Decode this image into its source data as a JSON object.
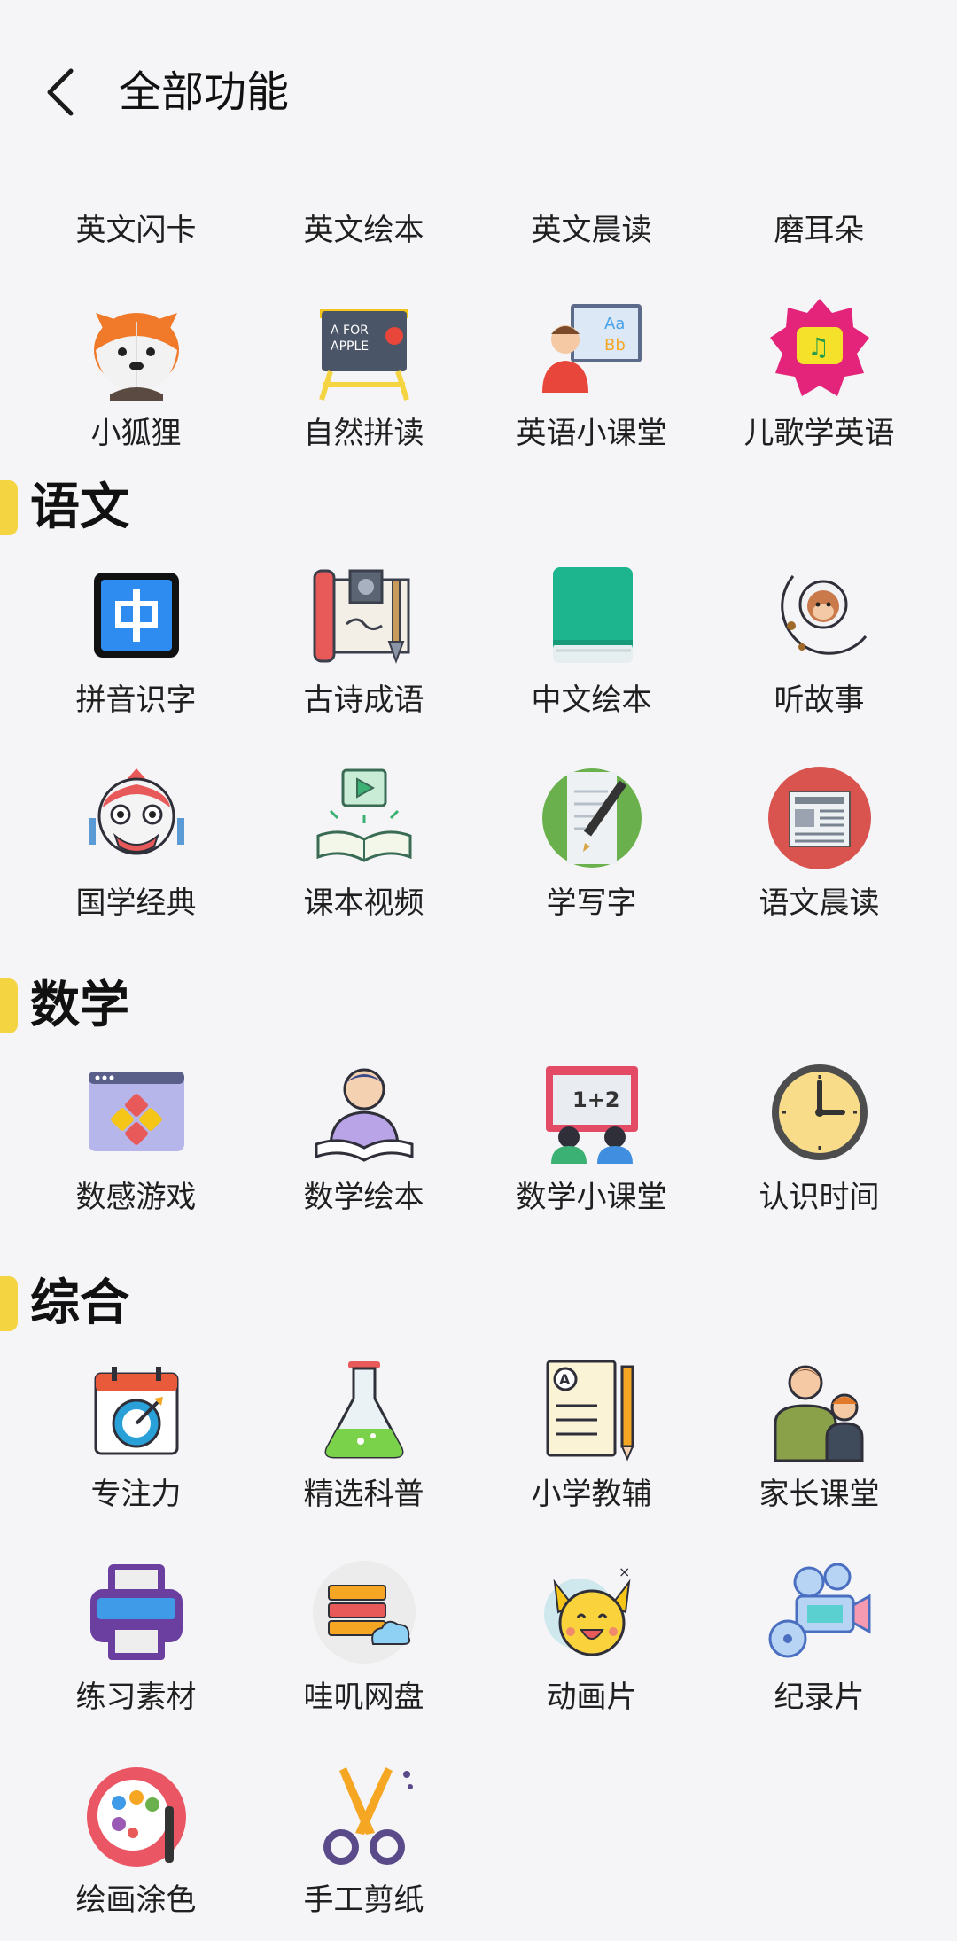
{
  "header": {
    "title": "全部功能"
  },
  "english_partial": [
    {
      "label": "英文闪卡",
      "icon": "flashcard-icon"
    },
    {
      "label": "英文绘本",
      "icon": "picture-book-icon"
    },
    {
      "label": "英文晨读",
      "icon": "morning-read-icon"
    },
    {
      "label": "磨耳朵",
      "icon": "ear-training-icon"
    }
  ],
  "english_row2": [
    {
      "label": "小狐狸",
      "icon": "fox-icon"
    },
    {
      "label": "自然拼读",
      "icon": "phonics-board-icon"
    },
    {
      "label": "英语小课堂",
      "icon": "english-class-icon"
    },
    {
      "label": "儿歌学英语",
      "icon": "music-badge-icon"
    }
  ],
  "sections": [
    {
      "title": "语文",
      "items": [
        {
          "label": "拼音识字",
          "icon": "pinyin-icon"
        },
        {
          "label": "古诗成语",
          "icon": "scroll-icon"
        },
        {
          "label": "中文绘本",
          "icon": "green-book-icon"
        },
        {
          "label": "听故事",
          "icon": "moon-monkey-icon"
        },
        {
          "label": "国学经典",
          "icon": "lion-dance-icon"
        },
        {
          "label": "课本视频",
          "icon": "video-book-icon"
        },
        {
          "label": "学写字",
          "icon": "writing-pen-icon"
        },
        {
          "label": "语文晨读",
          "icon": "newspaper-icon"
        }
      ]
    },
    {
      "title": "数学",
      "items": [
        {
          "label": "数感游戏",
          "icon": "calculator-window-icon"
        },
        {
          "label": "数学绘本",
          "icon": "reading-student-icon"
        },
        {
          "label": "数学小课堂",
          "icon": "math-class-icon"
        },
        {
          "label": "认识时间",
          "icon": "clock-icon"
        }
      ]
    },
    {
      "title": "综合",
      "items": [
        {
          "label": "专注力",
          "icon": "calendar-target-icon"
        },
        {
          "label": "精选科普",
          "icon": "flask-icon"
        },
        {
          "label": "小学教辅",
          "icon": "exam-paper-icon"
        },
        {
          "label": "家长课堂",
          "icon": "parent-child-icon"
        },
        {
          "label": "练习素材",
          "icon": "printer-icon"
        },
        {
          "label": "哇叽网盘",
          "icon": "cloud-server-icon"
        },
        {
          "label": "动画片",
          "icon": "cartoon-cat-icon"
        },
        {
          "label": "纪录片",
          "icon": "film-camera-icon"
        },
        {
          "label": "绘画涂色",
          "icon": "palette-icon"
        },
        {
          "label": "手工剪纸",
          "icon": "scissors-icon"
        }
      ]
    }
  ]
}
